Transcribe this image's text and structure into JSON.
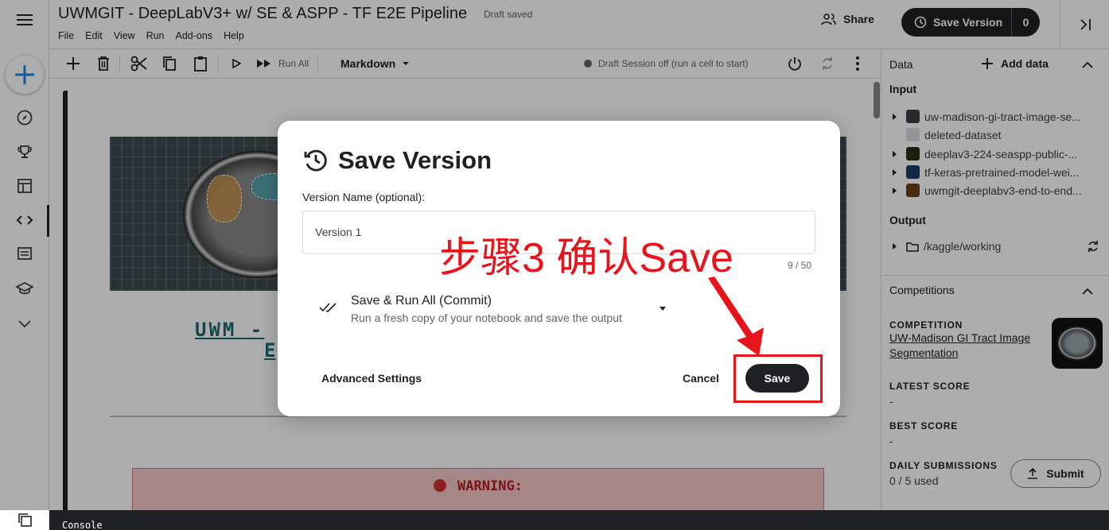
{
  "header": {
    "title": "UWMGIT - DeepLabV3+ w/ SE & ASPP - TF E2E Pipeline",
    "draft_status": "Draft saved",
    "menus": [
      "File",
      "Edit",
      "View",
      "Run",
      "Add-ons",
      "Help"
    ],
    "share_label": "Share",
    "save_version_label": "Save Version",
    "save_version_count": "0"
  },
  "toolbar": {
    "run_all_label": "Run All",
    "cell_type": "Markdown",
    "session_status": "Draft Session off (run a cell to start)"
  },
  "notebook": {
    "heading_line1": "UWM -",
    "heading_line2": "E",
    "warning_text": "WARNING:"
  },
  "right_panel": {
    "data_title": "Data",
    "add_data_label": "Add data",
    "input_title": "Input",
    "inputs": [
      {
        "name": "uw-madison-gi-tract-image-se...",
        "icon_color": "#3c4043"
      },
      {
        "name": "deleted-dataset",
        "icon_color": "#dadce0"
      },
      {
        "name": "deeplav3-224-seaspp-public-...",
        "icon_color": "#2d2d12"
      },
      {
        "name": "tf-keras-pretrained-model-wei...",
        "icon_color": "#1a3a66"
      },
      {
        "name": "uwmgit-deeplabv3-end-to-end...",
        "icon_color": "#6b3e16"
      }
    ],
    "output_title": "Output",
    "output_path": "/kaggle/working",
    "competitions_title": "Competitions",
    "competition_label": "COMPETITION",
    "competition_name": "UW-Madison GI Tract Image Segmentation",
    "latest_score_label": "LATEST SCORE",
    "latest_score": "-",
    "best_score_label": "BEST SCORE",
    "best_score": "-",
    "daily_submissions_label": "DAILY SUBMISSIONS",
    "daily_submissions": "0 / 5 used",
    "submit_label": "Submit"
  },
  "console": {
    "label": "Console"
  },
  "modal": {
    "title": "Save Version",
    "version_name_label": "Version Name (optional):",
    "version_name_value": "Version 1",
    "char_count": "9 / 50",
    "option_title": "Save & Run All (Commit)",
    "option_desc": "Run a fresh copy of your notebook and save the output",
    "advanced_label": "Advanced Settings",
    "cancel_label": "Cancel",
    "save_label": "Save"
  },
  "annotation": {
    "text": "步骤3 确认Save",
    "color": "#e8141c"
  },
  "icons": {
    "rail": [
      "menu-icon",
      "create-plus-icon",
      "compass-icon",
      "trophy-icon",
      "table-icon",
      "code-icon",
      "comment-icon",
      "school-icon",
      "chevron-down-icon",
      "copy-windows-icon"
    ]
  }
}
